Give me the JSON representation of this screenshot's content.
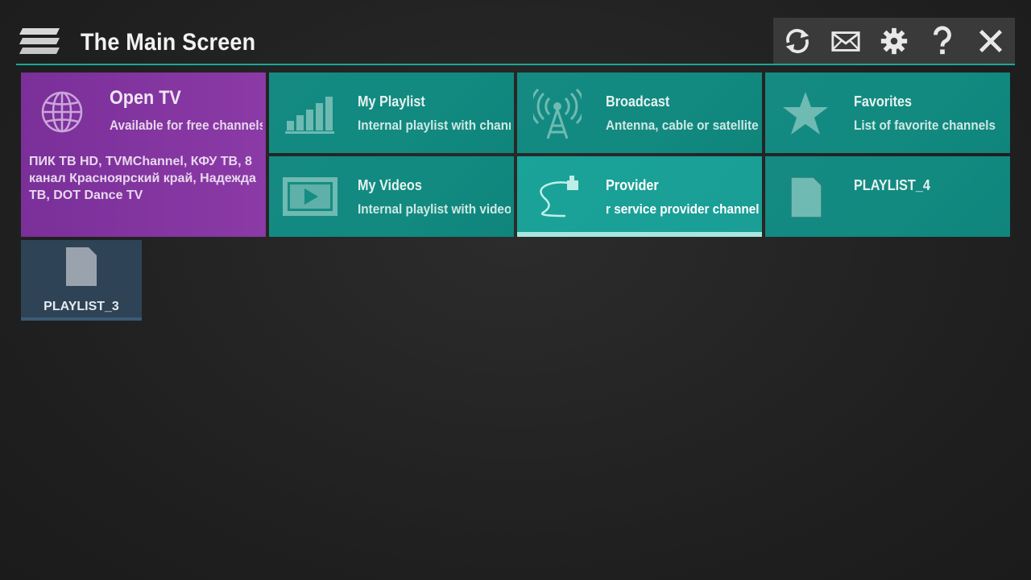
{
  "header": {
    "title": "The Main Screen",
    "menu_icon": "hamburger-stack-icon",
    "accent_color": "#1aa79b"
  },
  "toolbar": {
    "buttons": [
      {
        "icon": "refresh-icon",
        "label": "Refresh"
      },
      {
        "icon": "mail-icon",
        "label": "Messages"
      },
      {
        "icon": "gear-icon",
        "label": "Settings"
      },
      {
        "icon": "help-icon",
        "label": "Help"
      },
      {
        "icon": "close-icon",
        "label": "Close"
      }
    ]
  },
  "tiles": {
    "open_tv": {
      "title": "Open TV",
      "subtitle": "Available for free channels",
      "channels": "ПИК ТВ HD, TVMChannel, КФУ ТВ, 8 канал Красноярский край, Надежда ТВ, DOT Dance TV",
      "icon": "globe-icon",
      "color": "#8b3aa6"
    },
    "my_playlist": {
      "title": "My Playlist",
      "subtitle": "Internal playlist with channels",
      "icon": "signal-bars-icon"
    },
    "broadcast": {
      "title": "Broadcast",
      "subtitle": "Antenna, cable or satellite",
      "icon": "antenna-tower-icon"
    },
    "favorites": {
      "title": "Favorites",
      "subtitle": "List of favorite channels",
      "icon": "star-icon"
    },
    "my_videos": {
      "title": "My Videos",
      "subtitle": "Internal playlist with videos",
      "icon": "video-play-icon"
    },
    "provider": {
      "title": "Provider",
      "subtitle": "r service provider channels",
      "icon": "ethernet-cable-icon",
      "selected": true
    },
    "playlist_4": {
      "title": "PLAYLIST_4",
      "icon": "document-icon"
    },
    "playlist_3": {
      "title": "PLAYLIST_3",
      "icon": "document-icon"
    }
  }
}
